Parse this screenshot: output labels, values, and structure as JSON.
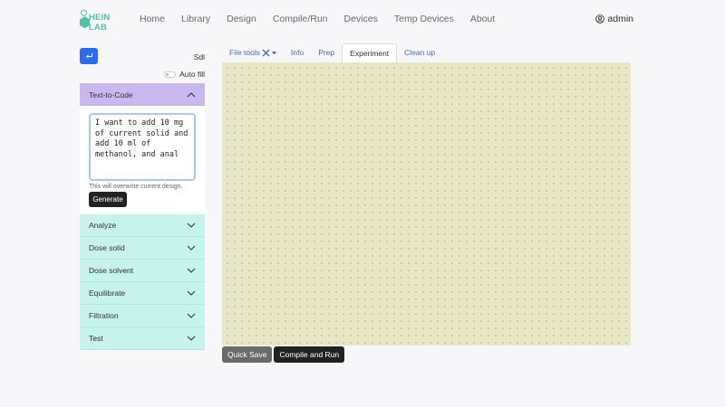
{
  "brand": {
    "logo_text": "HEIN LAB",
    "accent_color": "#4fc3a8"
  },
  "nav": {
    "items": [
      {
        "label": "Home"
      },
      {
        "label": "Library"
      },
      {
        "label": "Design"
      },
      {
        "label": "Compile/Run"
      },
      {
        "label": "Devices"
      },
      {
        "label": "Temp Devices"
      },
      {
        "label": "About"
      }
    ],
    "user": {
      "label": "admin",
      "icon": "user-circle-icon"
    }
  },
  "sidebar": {
    "back_icon": "return-arrow-icon",
    "sdl_label": "Sdl",
    "autofill_label": "Auto fill",
    "active_section": {
      "label": "Text-to-Code",
      "icon": "chevron-up-icon",
      "textarea_value": "I want to add 10 mg of current solid and add 10 ml of methanol, and anal",
      "warning": "This will overwrite current design.",
      "generate_label": "Generate"
    },
    "sections": [
      {
        "label": "Analyze",
        "icon": "chevron-down-icon"
      },
      {
        "label": "Dose solid",
        "icon": "chevron-down-icon"
      },
      {
        "label": "Dose solvent",
        "icon": "chevron-down-icon"
      },
      {
        "label": "Equilibrate",
        "icon": "chevron-down-icon"
      },
      {
        "label": "Filtration",
        "icon": "chevron-down-icon"
      },
      {
        "label": "Test",
        "icon": "chevron-down-icon"
      }
    ],
    "colors": {
      "active_header": "#c9b8ef",
      "section_bg": "#c6f4ec"
    }
  },
  "tabs": {
    "file_tools_label": "File tools",
    "file_tools_icon": "tools-icon",
    "items": [
      {
        "label": "Info"
      },
      {
        "label": "Prep"
      },
      {
        "label": "Experiment"
      },
      {
        "label": "Clean up"
      }
    ],
    "active": "Experiment"
  },
  "canvas": {
    "background": "#e7e7c6"
  },
  "actions": {
    "quick_save_label": "Quick Save",
    "compile_run_label": "Compile and Run"
  }
}
